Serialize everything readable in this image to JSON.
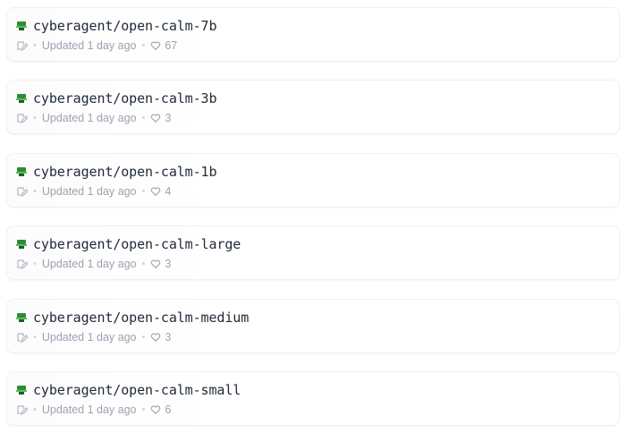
{
  "models": [
    {
      "name": "cyberagent/open-calm-7b",
      "updated": "Updated 1 day ago",
      "likes": "67"
    },
    {
      "name": "cyberagent/open-calm-3b",
      "updated": "Updated 1 day ago",
      "likes": "3"
    },
    {
      "name": "cyberagent/open-calm-1b",
      "updated": "Updated 1 day ago",
      "likes": "4"
    },
    {
      "name": "cyberagent/open-calm-large",
      "updated": "Updated 1 day ago",
      "likes": "3"
    },
    {
      "name": "cyberagent/open-calm-medium",
      "updated": "Updated 1 day ago",
      "likes": "3"
    },
    {
      "name": "cyberagent/open-calm-small",
      "updated": "Updated 1 day ago",
      "likes": "6"
    }
  ],
  "separator": "•",
  "icons": {
    "avatar": "cyberagent-avatar-icon",
    "task": "text-generation-task-icon",
    "likes": "heart-icon"
  },
  "colors": {
    "avatar_green": "#2e8b3a",
    "meta_text": "#9ca3af",
    "title_text": "#1f2937"
  }
}
